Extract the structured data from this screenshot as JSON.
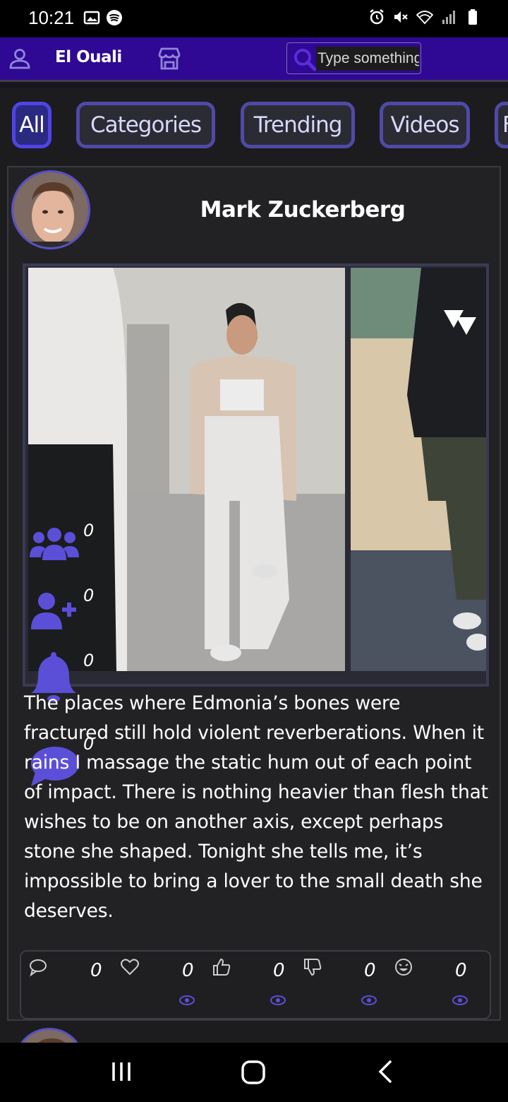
{
  "status_bar": {
    "time": "10:21",
    "left_icons": [
      "gallery-icon",
      "spotify-icon"
    ],
    "right_icons": [
      "alarm-icon",
      "mute-icon",
      "wifi-icon",
      "signal-icon",
      "battery-icon"
    ]
  },
  "header": {
    "user_name": "El Ouali",
    "search_placeholder": "Type something",
    "accent": "#2f0894"
  },
  "tabs": [
    {
      "label": "All",
      "active": true
    },
    {
      "label": "Categories",
      "active": false
    },
    {
      "label": "Trending",
      "active": false
    },
    {
      "label": "Videos",
      "active": false
    },
    {
      "label": "F",
      "active": false
    }
  ],
  "post": {
    "author": "Mark Zuckerberg",
    "side_actions": [
      {
        "icon": "group-icon",
        "count": "0"
      },
      {
        "icon": "add-user-icon",
        "count": "0"
      },
      {
        "icon": "bell-icon",
        "count": "0"
      },
      {
        "icon": "comment-bubble-icon",
        "count": "0"
      }
    ],
    "text": "The places where Edmonia’s bones were fractured still hold violent reverberations. When it rains I massage the static hum out of each point of impact. There is nothing heavier than flesh that wishes to be on another axis, except perhaps stone she shaped. Tonight she tells me, it’s impossible to bring a lover to the small death she deserves.",
    "stats": [
      {
        "icon": "comment-icon",
        "count": "0"
      },
      {
        "icon": "heart-icon",
        "count": "0"
      },
      {
        "icon": "thumbs-up-icon",
        "count": "0"
      },
      {
        "icon": "thumbs-down-icon",
        "count": "0"
      },
      {
        "icon": "laugh-icon",
        "count": "0"
      }
    ]
  },
  "nav_bar": {
    "buttons": [
      "recent-apps-icon",
      "home-icon",
      "back-icon"
    ]
  }
}
